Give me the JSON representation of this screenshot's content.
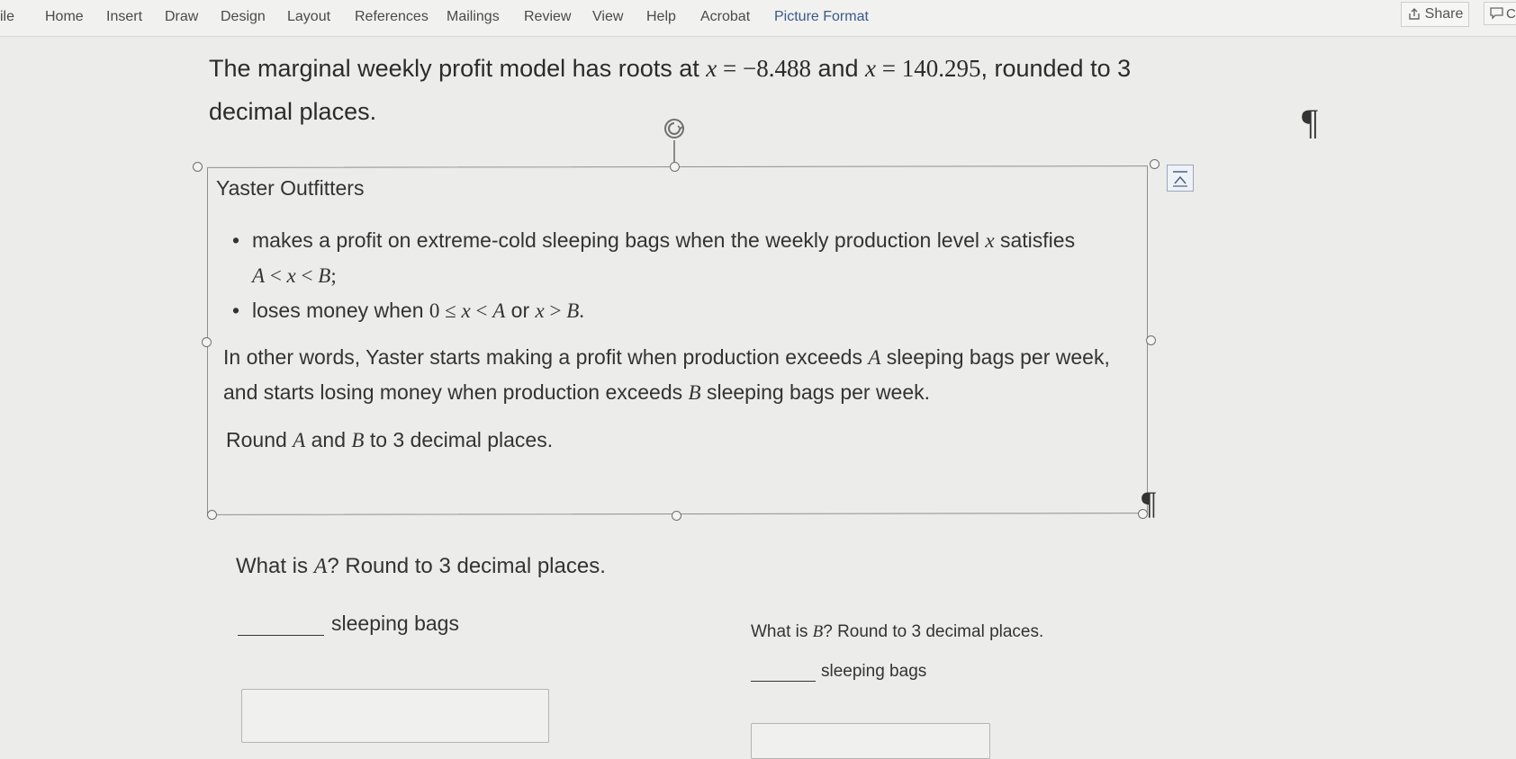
{
  "ribbon": {
    "tabs": [
      "ile",
      "Home",
      "Insert",
      "Draw",
      "Design",
      "Layout",
      "References",
      "Mailings",
      "Review",
      "View",
      "Help",
      "Acrobat",
      "Picture Format"
    ],
    "share_label": "Share",
    "comment_label": "C"
  },
  "intro": {
    "text_1": "The marginal weekly profit model has roots at ",
    "var_1": "x",
    "eq_1": " = −8.488",
    "and": " and ",
    "var_2": "x",
    "eq_2": " = 140.295",
    "text_2": ", rounded to 3",
    "text_3": "decimal places."
  },
  "pilcrow": "¶",
  "textbox": {
    "title": "Yaster Outfitters",
    "bullet_1_text": "makes a profit on extreme-cold sleeping bags when the weekly production level ",
    "bullet_1_var": "x",
    "bullet_1_end": " satisfies",
    "bullet_1_ineq_A": "A",
    "bullet_1_ineq_lt1": " < ",
    "bullet_1_ineq_x": "x",
    "bullet_1_ineq_lt2": " < ",
    "bullet_1_ineq_B": "B",
    "bullet_1_ineq_semi": ";",
    "bullet_2_text": "loses money when ",
    "bullet_2_zero": "0 ≤ ",
    "bullet_2_x": "x",
    "bullet_2_lt": " < ",
    "bullet_2_A": "A",
    "bullet_2_or": " or ",
    "bullet_2_x2": "x",
    "bullet_2_gt": " > ",
    "bullet_2_B": "B",
    "bullet_2_period": ".",
    "para_1_a": "In other words, Yaster starts making a profit when production exceeds ",
    "para_1_A": "A",
    "para_1_b": " sleeping bags per week,",
    "para_1_c": "and starts losing money when production exceeds ",
    "para_1_B": "B",
    "para_1_d": " sleeping bags per week.",
    "para_2_a": "Round ",
    "para_2_A": "A",
    "para_2_and": " and ",
    "para_2_B": "B",
    "para_2_b": " to 3 decimal places."
  },
  "question_a": {
    "prefix": "What is ",
    "var": "A",
    "suffix": "? Round to 3 decimal places.",
    "unit": "sleeping bags"
  },
  "question_b": {
    "prefix": "What is ",
    "var": "B",
    "suffix": "? Round to 3 decimal places.",
    "unit": "sleeping bags"
  }
}
